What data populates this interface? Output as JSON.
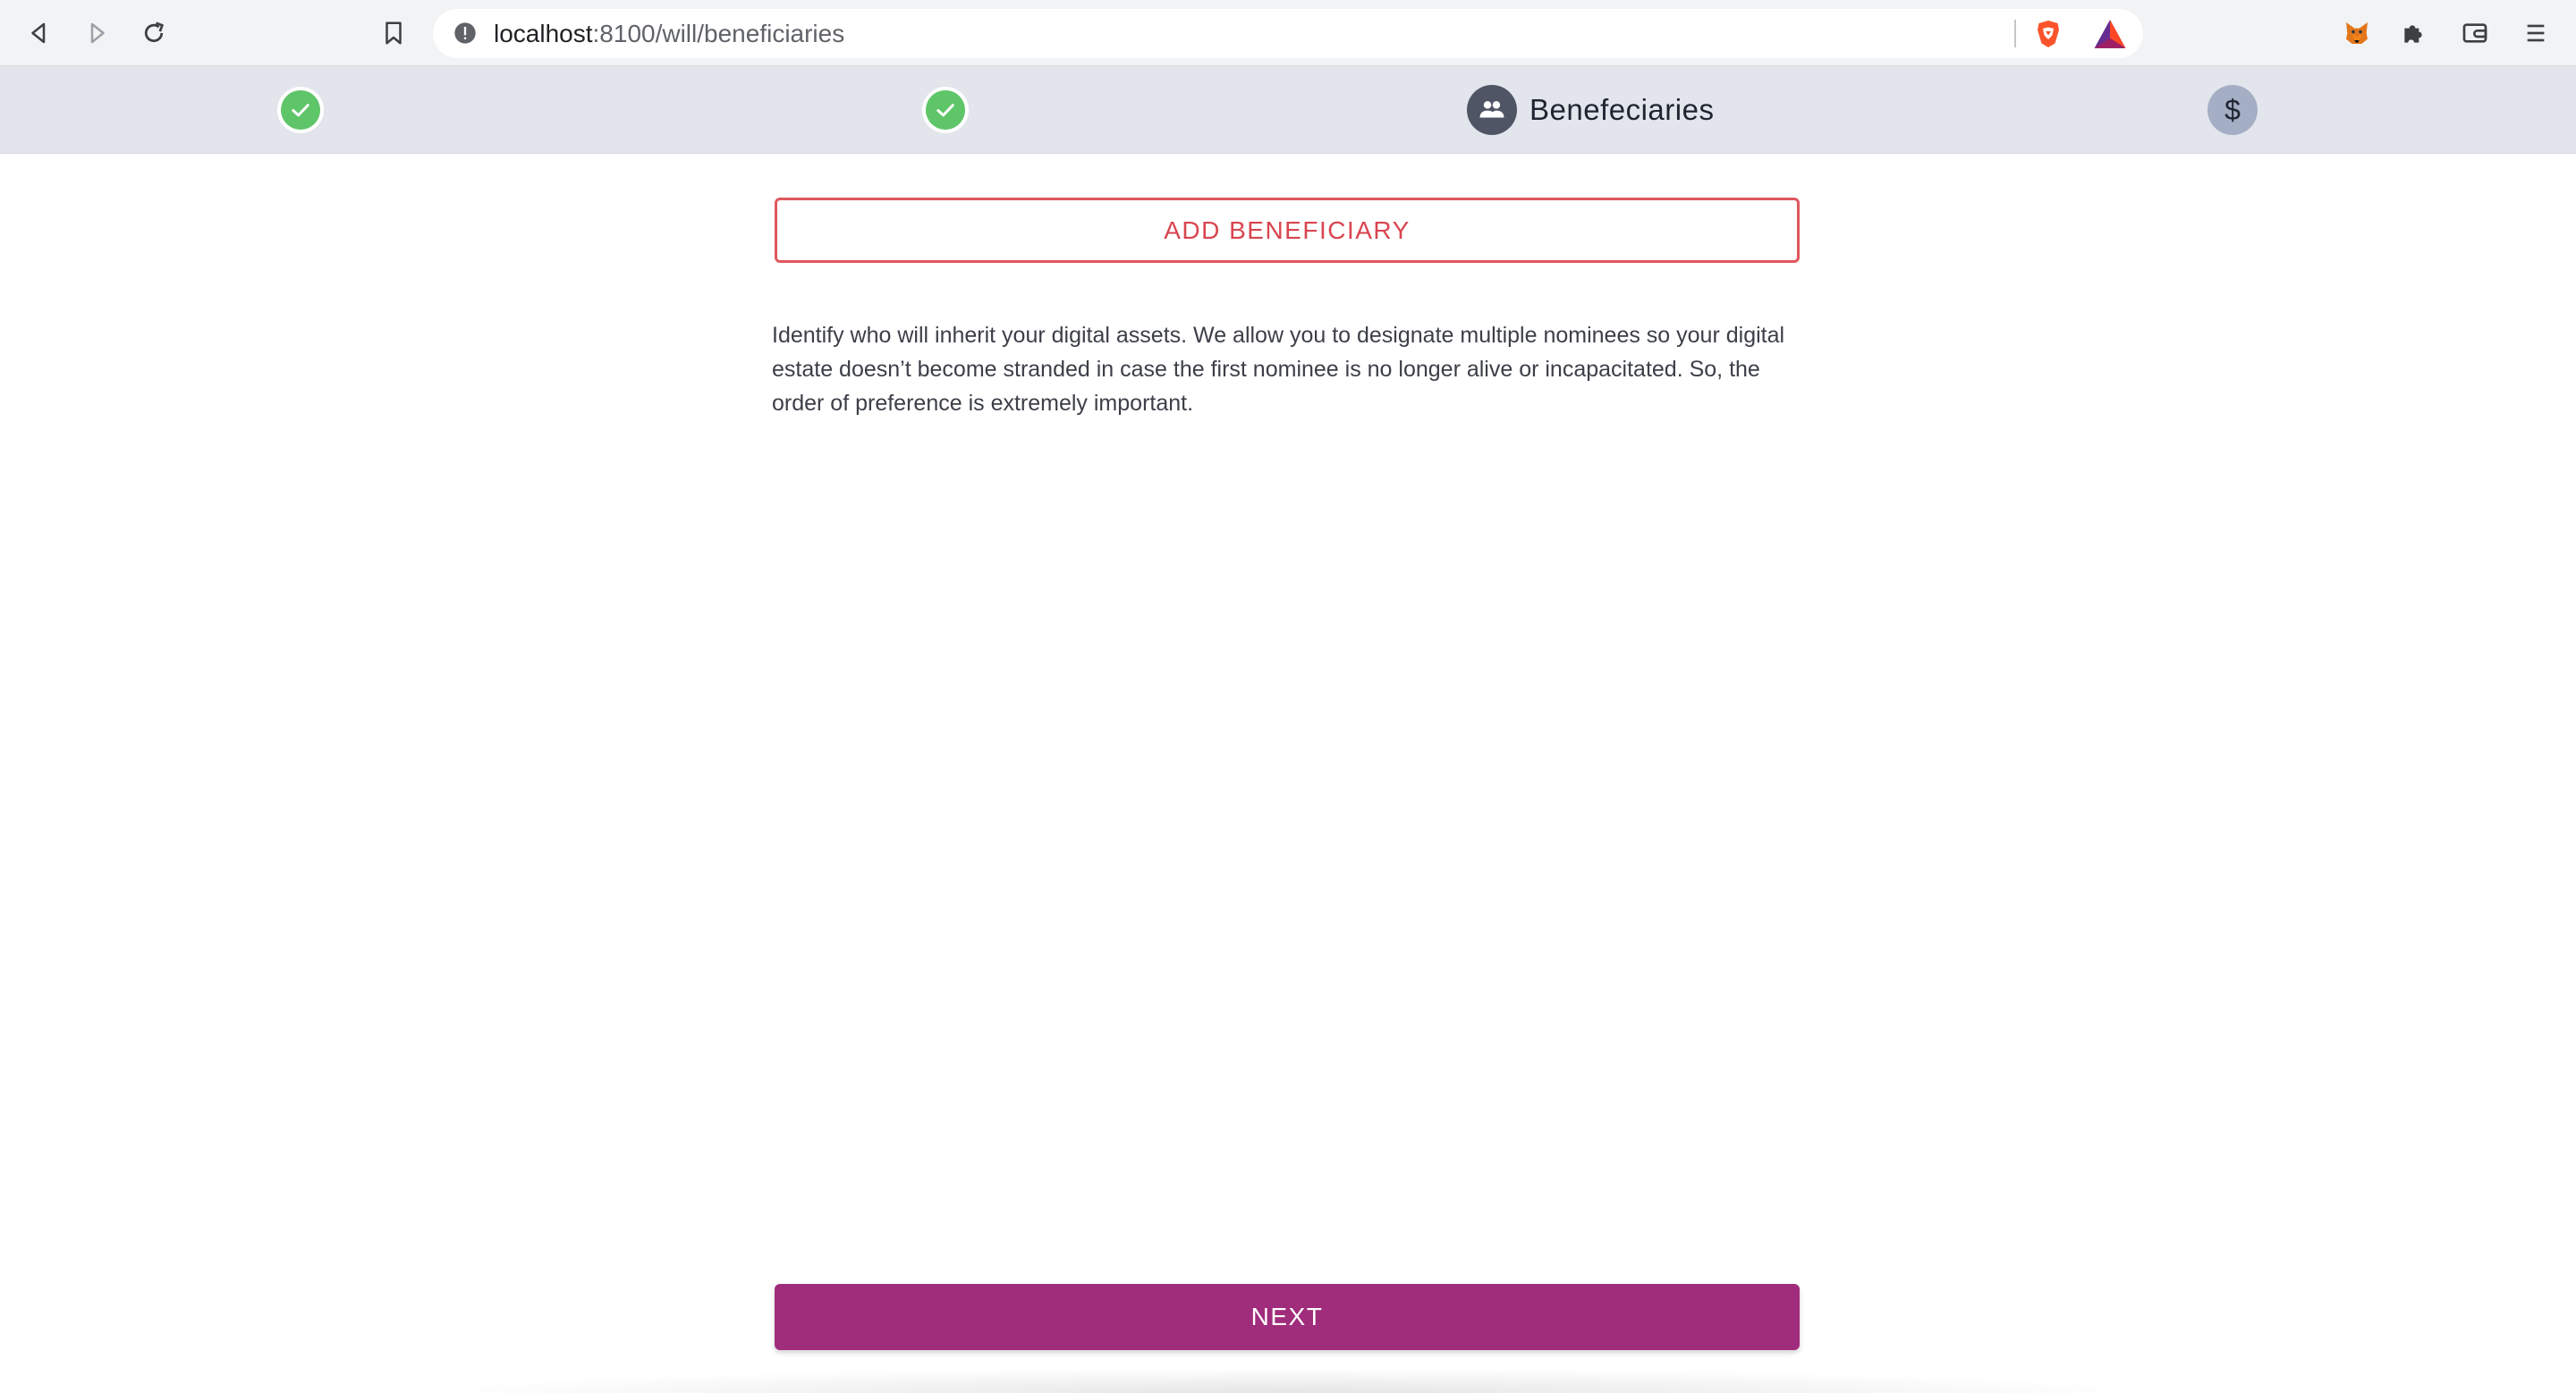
{
  "browser": {
    "url_host": "localhost",
    "url_path": ":8100/will/beneficiaries",
    "icons": {
      "back": "back-icon",
      "forward": "forward-icon",
      "reload": "reload-icon",
      "bookmark": "bookmark-icon",
      "site_info": "info-icon",
      "brave": "brave-shield-icon",
      "rewards": "bat-rewards-icon",
      "metamask": "metamask-fox-icon",
      "extensions": "puzzle-icon",
      "wallet": "wallet-icon",
      "menu": "hamburger-menu-icon"
    }
  },
  "stepper": {
    "active_label": "Benefeciaries",
    "pending_symbol": "$",
    "colors": {
      "completed": "#5ec569",
      "active": "#4f5564",
      "pending": "#a4aec4"
    }
  },
  "main": {
    "add_button_label": "ADD BENEFICIARY",
    "description": "Identify who will inherit your digital assets. We allow you to designate multiple nominees so your digital estate doesn’t become stranded in case the first nominee is no longer alive or incapacitated. So, the order of preference is extremely important.",
    "next_button_label": "NEXT",
    "colors": {
      "add_button": "#e0575e",
      "next_button": "#a02c7c"
    }
  }
}
